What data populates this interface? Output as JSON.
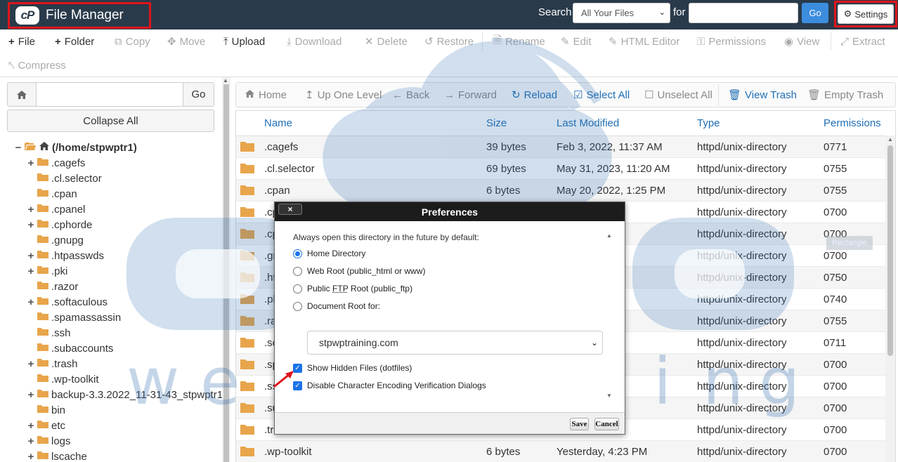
{
  "header": {
    "app_title": "File Manager",
    "logo_text": "cP",
    "search_label": "Search",
    "search_scope": "All Your Files",
    "for_label": "for",
    "search_value": "",
    "go_label": "Go",
    "settings_label": "Settings"
  },
  "toolbar": {
    "file": "File",
    "folder": "Folder",
    "copy": "Copy",
    "move": "Move",
    "upload": "Upload",
    "download": "Download",
    "delete": "Delete",
    "restore": "Restore",
    "rename": "Rename",
    "edit": "Edit",
    "html_editor": "HTML Editor",
    "permissions": "Permissions",
    "view": "View",
    "extract": "Extract",
    "compress": "Compress"
  },
  "sidebar": {
    "path_value": "",
    "go_label": "Go",
    "collapse_label": "Collapse All",
    "root_label": "(/home/stpwptr1)",
    "items": [
      {
        "label": ".cagefs",
        "expandable": true
      },
      {
        "label": ".cl.selector",
        "expandable": false
      },
      {
        "label": ".cpan",
        "expandable": false
      },
      {
        "label": ".cpanel",
        "expandable": true
      },
      {
        "label": ".cphorde",
        "expandable": true
      },
      {
        "label": ".gnupg",
        "expandable": false
      },
      {
        "label": ".htpasswds",
        "expandable": true
      },
      {
        "label": ".pki",
        "expandable": true
      },
      {
        "label": ".razor",
        "expandable": false
      },
      {
        "label": ".softaculous",
        "expandable": true
      },
      {
        "label": ".spamassassin",
        "expandable": false
      },
      {
        "label": ".ssh",
        "expandable": false
      },
      {
        "label": ".subaccounts",
        "expandable": false
      },
      {
        "label": ".trash",
        "expandable": true
      },
      {
        "label": ".wp-toolkit",
        "expandable": false
      },
      {
        "label": "backup-3.3.2022_11-31-43_stpwptr1",
        "expandable": true
      },
      {
        "label": "bin",
        "expandable": false
      },
      {
        "label": "etc",
        "expandable": true
      },
      {
        "label": "logs",
        "expandable": true
      },
      {
        "label": "lscache",
        "expandable": true
      }
    ]
  },
  "nav": {
    "home": "Home",
    "up": "Up One Level",
    "back": "Back",
    "forward": "Forward",
    "reload": "Reload",
    "select_all": "Select All",
    "unselect_all": "Unselect All",
    "view_trash": "View Trash",
    "empty_trash": "Empty Trash"
  },
  "table": {
    "columns": [
      "Name",
      "Size",
      "Last Modified",
      "Type",
      "Permissions"
    ],
    "rows": [
      {
        "name": ".cagefs",
        "size": "39 bytes",
        "modified": "Feb 3, 2022, 11:37 AM",
        "type": "httpd/unix-directory",
        "perms": "0771"
      },
      {
        "name": ".cl.selector",
        "size": "69 bytes",
        "modified": "May 31, 2023, 11:20 AM",
        "type": "httpd/unix-directory",
        "perms": "0755"
      },
      {
        "name": ".cpan",
        "size": "6 bytes",
        "modified": "May 20, 2022, 1:25 PM",
        "type": "httpd/unix-directory",
        "perms": "0755"
      },
      {
        "name": ".cp",
        "size": "",
        "modified": "M",
        "type": "httpd/unix-directory",
        "perms": "0700"
      },
      {
        "name": ".cp",
        "size": "",
        "modified": "2 PM",
        "type": "httpd/unix-directory",
        "perms": "0700"
      },
      {
        "name": ".gr",
        "size": "",
        "modified": ":41 PM",
        "type": "httpd/unix-directory",
        "perms": "0700"
      },
      {
        "name": ".ht",
        "size": "",
        "modified": ":50 AM",
        "type": "httpd/unix-directory",
        "perms": "0750"
      },
      {
        "name": ".pl",
        "size": "",
        "modified": ":34 AM",
        "type": "httpd/unix-directory",
        "perms": "0740"
      },
      {
        "name": ".ra",
        "size": "",
        "modified": ":24 PM",
        "type": "httpd/unix-directory",
        "perms": "0755"
      },
      {
        "name": ".so",
        "size": "",
        "modified": "1:07 AM",
        "type": "httpd/unix-directory",
        "perms": "0711"
      },
      {
        "name": ".sp",
        "size": "",
        "modified": ":33 AM",
        "type": "httpd/unix-directory",
        "perms": "0700"
      },
      {
        "name": ".ss",
        "size": "",
        "modified": ":06 PM",
        "type": "httpd/unix-directory",
        "perms": "0700"
      },
      {
        "name": ".su",
        "size": "",
        "modified": ":40 PM",
        "type": "httpd/unix-directory",
        "perms": "0700"
      },
      {
        "name": ".tr",
        "size": "",
        "modified": ":7 PM",
        "type": "httpd/unix-directory",
        "perms": "0700"
      },
      {
        "name": ".wp-toolkit",
        "size": "6 bytes",
        "modified": "Yesterday, 4:23 PM",
        "type": "httpd/unix-directory",
        "perms": "0700"
      }
    ]
  },
  "watermark": {
    "tag": "Rectangle",
    "letters": [
      "w",
      "e",
      "b",
      "h",
      "o",
      "s",
      "t",
      "i",
      "n",
      "g"
    ]
  },
  "dialog": {
    "title": "Preferences",
    "close_label": "×",
    "intro": "Always open this directory in the future by default:",
    "radio_home": "Home Directory",
    "radio_web_root": "Web Root (public_html or www)",
    "radio_ftp_pre": "Public",
    "radio_ftp_abbr": "FTP",
    "radio_ftp_post": "Root (public_ftp)",
    "radio_doc_root": "Document Root for:",
    "domain": "stpwptraining.com",
    "check_hidden": "Show Hidden Files (dotfiles)",
    "check_encoding": "Disable Character Encoding Verification Dialogs",
    "hidden_checked": true,
    "encoding_checked": true,
    "selected_radio": "Home Directory",
    "save_label": "Save",
    "cancel_label": "Cancel"
  },
  "colors": {
    "header_bg": "#293a4a",
    "link_blue": "#1f6fb5",
    "highlight_red": "#e0151b",
    "folder": "#e8a54b",
    "watermark": "#2e6db0"
  }
}
